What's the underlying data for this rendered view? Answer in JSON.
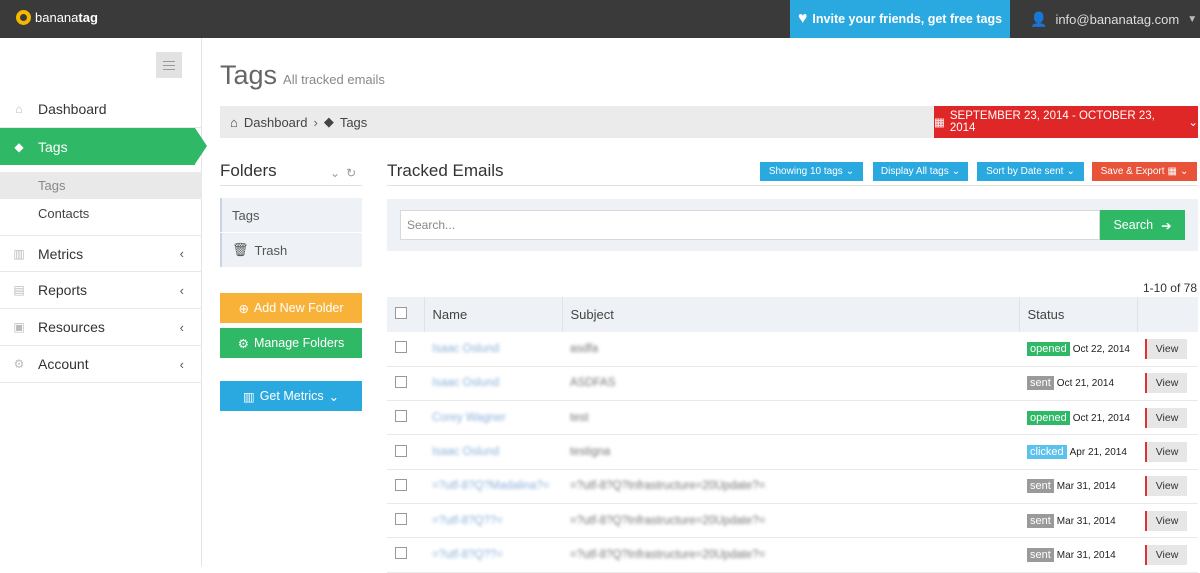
{
  "topbar": {
    "logo_part1": "banana",
    "logo_part2": "tag",
    "invite_text": "Invite your friends, get free tags",
    "user_email": "info@bananatag.com"
  },
  "sidebar": {
    "items": [
      {
        "label": "Dashboard",
        "icon": "home-icon"
      },
      {
        "label": "Tags",
        "icon": "tags-icon"
      },
      {
        "label": "Metrics",
        "icon": "bar-chart-icon"
      },
      {
        "label": "Reports",
        "icon": "list-icon"
      },
      {
        "label": "Resources",
        "icon": "book-icon"
      },
      {
        "label": "Account",
        "icon": "gear-icon"
      }
    ],
    "sub_items": [
      "Tags",
      "Contacts"
    ]
  },
  "header": {
    "title": "Tags",
    "subtitle": "All tracked emails",
    "breadcrumb": [
      "Dashboard",
      "Tags"
    ],
    "date_range": "SEPTEMBER 23, 2014 - OCTOBER 23, 2014"
  },
  "folders": {
    "heading": "Folders",
    "items": [
      "Tags",
      "Trash"
    ],
    "add_label": "Add New Folder",
    "manage_label": "Manage Folders",
    "metrics_label": "Get Metrics"
  },
  "tracked": {
    "heading": "Tracked Emails",
    "showing_label": "Showing 10 tags",
    "display_label": "Display All tags",
    "sort_label": "Sort by Date sent",
    "export_label": "Save & Export",
    "search_placeholder": "Search...",
    "search_button": "Search",
    "count_text": "1-10 of 78",
    "columns": [
      "Name",
      "Subject",
      "Status"
    ],
    "view_label": "View",
    "rows": [
      {
        "name": "Isaac Oslund",
        "subject": "asdfa",
        "status": "opened",
        "date": "Oct 22, 2014"
      },
      {
        "name": "Isaac Oslund",
        "subject": "ASDFAS",
        "status": "sent",
        "date": "Oct 21, 2014"
      },
      {
        "name": "Corey Wagner",
        "subject": "test",
        "status": "opened",
        "date": "Oct 21, 2014"
      },
      {
        "name": "Isaac Oslund",
        "subject": "testigna",
        "status": "clicked",
        "date": "Apr 21, 2014"
      },
      {
        "name": "=?utf-8?Q?Madalina?=",
        "subject": "=?utf-8?Q?Infrastructure=20Update?=",
        "status": "sent",
        "date": "Mar 31, 2014"
      },
      {
        "name": "=?utf-8?Q??=",
        "subject": "=?utf-8?Q?Infrastructure=20Update?=",
        "status": "sent",
        "date": "Mar 31, 2014"
      },
      {
        "name": "=?utf-8?Q??=",
        "subject": "=?utf-8?Q?Infrastructure=20Update?=",
        "status": "sent",
        "date": "Mar 31, 2014"
      }
    ]
  },
  "colors": {
    "green": "#2fb866",
    "blue": "#2aa9e0",
    "red": "#e02727",
    "yellow": "#f8b23a",
    "topbar": "#3a3a3a"
  }
}
